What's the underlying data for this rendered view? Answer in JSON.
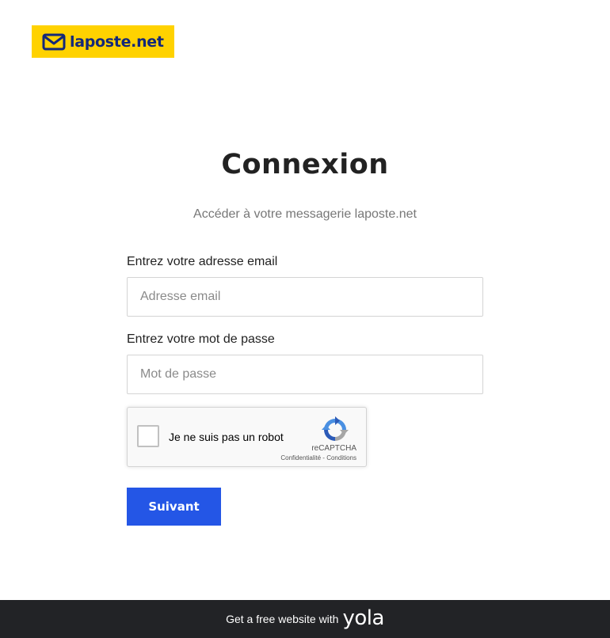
{
  "header": {
    "logo_text": "laposte.net",
    "logo_icon": "envelope-icon",
    "logo_bg_color": "#ffd200",
    "logo_fg_color": "#13287a"
  },
  "main": {
    "title": "Connexion",
    "subtitle": "Accéder à votre messagerie laposte.net"
  },
  "form": {
    "email_label": "Entrez votre adresse email",
    "email_placeholder": "Adresse email",
    "email_value": "",
    "password_label": "Entrez votre mot de passe",
    "password_placeholder": "Mot de passe",
    "password_value": "",
    "submit_label": "Suivant",
    "submit_color": "#2456e6"
  },
  "recaptcha": {
    "label": "Je ne suis pas un robot",
    "brand": "reCAPTCHA",
    "privacy_link": "Confidentialité",
    "separator": " - ",
    "terms_link": "Conditions",
    "checked": false,
    "icon": "recaptcha-logo-icon"
  },
  "footer": {
    "text": "Get a free website with",
    "brand": "yola",
    "bg_color": "#222326"
  }
}
